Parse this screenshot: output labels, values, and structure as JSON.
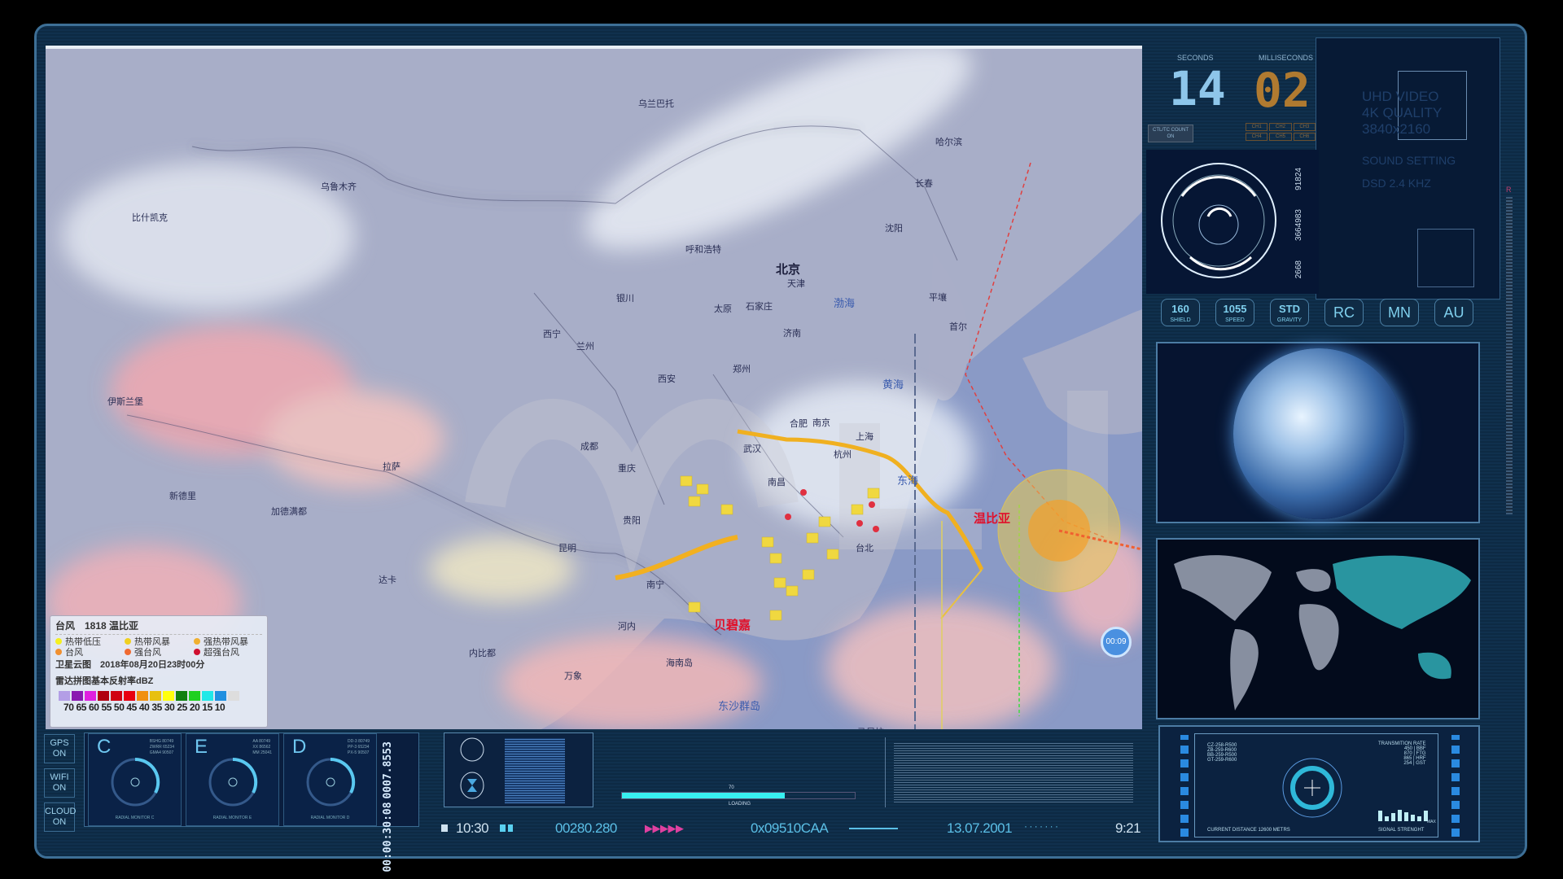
{
  "map": {
    "cities": [
      "乌兰巴托",
      "哈尔滨",
      "乌鲁木齐",
      "比什凯克",
      "长春",
      "沈阳",
      "呼和浩特",
      "北京",
      "天津",
      "银川",
      "太原",
      "石家庄",
      "平壤",
      "首尔",
      "西宁",
      "兰州",
      "济南",
      "西安",
      "郑州",
      "合肥",
      "南京",
      "上海",
      "成都",
      "武汉",
      "杭州",
      "重庆",
      "拉萨",
      "南昌",
      "贵阳",
      "昆明",
      "台北",
      "南宁",
      "河内",
      "内比都",
      "万象",
      "海南岛",
      "新德里",
      "伊斯兰堡",
      "加德满都",
      "达卡",
      "马尼拉"
    ],
    "seas": [
      "渤海",
      "黄海",
      "东海",
      "东沙群岛"
    ],
    "typhoons": [
      "温比亚",
      "贝碧嘉"
    ],
    "timer_badge": "00:09",
    "legend": {
      "title": "台风　1818 温比亚",
      "categories": [
        {
          "label": "热带低压",
          "color": "#f5f020"
        },
        {
          "label": "热带风暴",
          "color": "#f0d020"
        },
        {
          "label": "强热带风暴",
          "color": "#f0b030"
        },
        {
          "label": "台风",
          "color": "#f09030"
        },
        {
          "label": "强台风",
          "color": "#f06a30"
        },
        {
          "label": "超强台风",
          "color": "#d01030"
        }
      ],
      "satellite": "卫星云图　2018年08月20日23时00分",
      "radar_title": "雷达拼图基本反射率dBZ",
      "scale_colors": [
        "#b39ee6",
        "#8a1ab0",
        "#e020e0",
        "#b00010",
        "#d00010",
        "#e80010",
        "#f09010",
        "#e8c010",
        "#ffff10",
        "#108010",
        "#20d020",
        "#20e8e8",
        "#2090e0",
        "#dddddd"
      ],
      "scale_labels": "70 65 60 55 50 45 40 35 30 25 20 15 10"
    }
  },
  "timer": {
    "seconds_label": "SECONDS",
    "ms_label": "MILLISECONDS",
    "seconds": "14",
    "ms": "02",
    "count_btn": "CTL/TC COUNT ON",
    "ch": [
      "CH1",
      "CH2",
      "CH3",
      "CH4",
      "CH5",
      "CH6"
    ]
  },
  "video": {
    "l1": "UHD VIDEO",
    "l2": "4K QUALITY",
    "l3": "3840x2160",
    "l4": "SOUND SETTING",
    "l5": "DSD 2.4 KHZ"
  },
  "readouts": [
    "91824",
    "3664983",
    "2668"
  ],
  "buttons": [
    {
      "v": "160",
      "l": "SHIELD"
    },
    {
      "v": "1055",
      "l": "SPEED"
    },
    {
      "v": "STD",
      "l": "GRAVITY"
    },
    {
      "v": "RC"
    },
    {
      "v": "MN"
    },
    {
      "v": "AU"
    }
  ],
  "side_buttons": [
    {
      "a": "GPS",
      "b": "ON"
    },
    {
      "a": "WIFI",
      "b": "ON"
    },
    {
      "a": "CLOUD",
      "b": "ON"
    }
  ],
  "monitors": [
    {
      "letter": "C",
      "stats": "BSHG 80749 / ZWRR 65234 / GMA4 90507",
      "footer": "RADIAL MONITOR C"
    },
    {
      "letter": "E",
      "stats": "AA 80749 / XX 86562 / MM 25041",
      "footer": "RADIAL MONITOR E"
    },
    {
      "letter": "D",
      "stats": "DD-3 80749 / PP-3 65234 / PX-5 90507",
      "footer": "RADIAL MONITOR D"
    }
  ],
  "vertical_readouts": [
    "00:00:30:08",
    "0007.8553"
  ],
  "loading": {
    "label": "LOADING",
    "value_text": "70",
    "percent": 70
  },
  "status": {
    "time": "10:30",
    "counter": "00280.280",
    "hex": "0x09510CAA",
    "date": "13.07.2001",
    "end": "9:21"
  },
  "nav": {
    "codes": [
      "CZ-258-R500",
      "ZB-259-R600",
      "BB-259-R500",
      "GT-259-R600"
    ],
    "rate_title": "TRANSMITION RATE",
    "rates": [
      "450 | BBF",
      "870 | FTG",
      "865 | HRF",
      "254 | GST"
    ],
    "distance": "CURRENT DISTANCE  12600 METRS",
    "signal": "SIGNAL STRENGHT",
    "max": "MAX",
    "signal_levels": [
      0.8,
      0.4,
      0.6,
      0.9,
      0.7,
      0.5,
      0.4,
      0.8
    ]
  }
}
